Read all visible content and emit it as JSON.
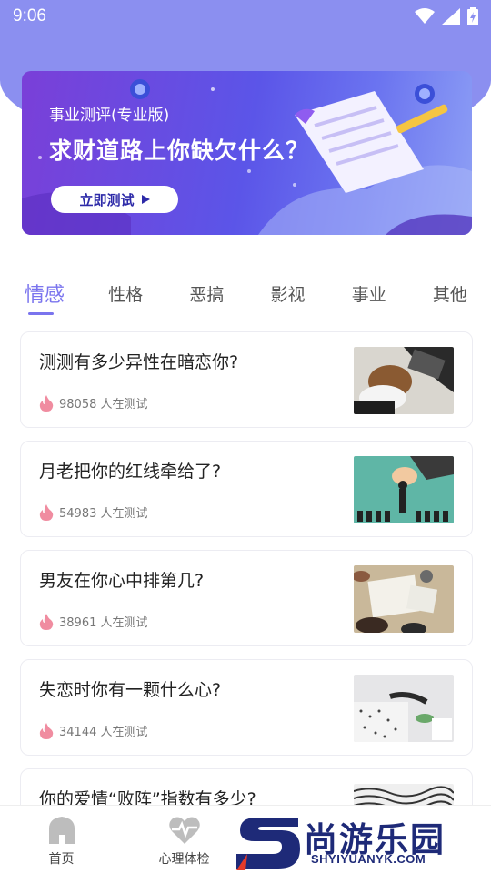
{
  "status_bar": {
    "time": "9:06",
    "icons": [
      "wifi-icon",
      "signal-icon",
      "battery-icon"
    ]
  },
  "banner": {
    "subtitle": "事业测评(专业版)",
    "title": "求财道路上你缺欠什么？",
    "button_label": "立即测试"
  },
  "tabs": [
    {
      "label": "情感",
      "active": true
    },
    {
      "label": "性格",
      "active": false
    },
    {
      "label": "恶搞",
      "active": false
    },
    {
      "label": "影视",
      "active": false
    },
    {
      "label": "事业",
      "active": false
    },
    {
      "label": "其他",
      "active": false
    }
  ],
  "tests": [
    {
      "title": "测测有多少异性在暗恋你?",
      "count": "98058 人在测试",
      "icon": "flame-icon"
    },
    {
      "title": "月老把你的红线牵给了?",
      "count": "54983 人在测试",
      "icon": "flame-icon"
    },
    {
      "title": "男友在你心中排第几?",
      "count": "38961 人在测试",
      "icon": "flame-icon"
    },
    {
      "title": "失恋时你有一颗什么心?",
      "count": "34144 人在测试",
      "icon": "flame-icon"
    },
    {
      "title": "你的爱情“败阵”指数有多少?",
      "count": "",
      "icon": "flame-icon"
    }
  ],
  "bottom_nav": [
    {
      "label": "首页",
      "icon": "home-icon"
    },
    {
      "label": "心理体检",
      "icon": "heartbeat-icon"
    }
  ],
  "watermark": {
    "brand_cn": "尚游乐园",
    "brand_url": "SHYIYUANYK.COM",
    "logo_letter": "S"
  },
  "colors": {
    "header": "#8b8ff0",
    "accent": "#7a74ee",
    "flame": "#f08ca0",
    "watermark": "#1e2a78"
  }
}
